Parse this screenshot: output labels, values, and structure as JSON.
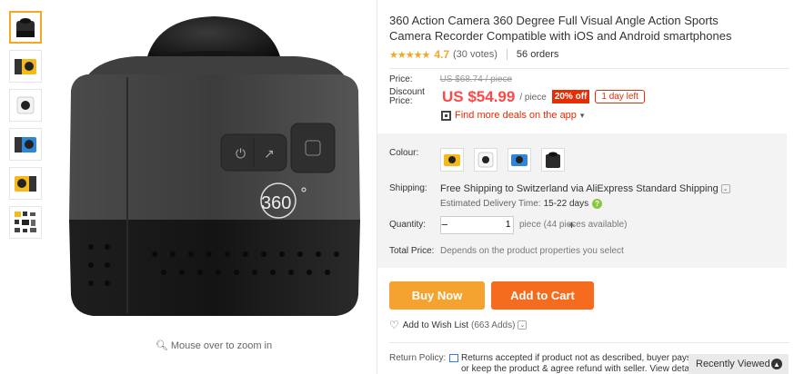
{
  "product": {
    "title": "360 Action Camera 360 Degree Full Visual Angle Action Sports Camera Recorder Compatible with iOS and Android smartphones",
    "rating_stars": "★★★★★",
    "rating": "4.7",
    "votes": "(30 votes)",
    "orders": "56 orders",
    "main_image_text": "360",
    "zoom_hint": "Mouse over to zoom in"
  },
  "thumbnails": [
    {
      "icon": "black-cube-camera-thumb"
    },
    {
      "icon": "yellow-camera-thumb"
    },
    {
      "icon": "white-camera-thumb"
    },
    {
      "icon": "blue-camera-thumb"
    },
    {
      "icon": "yellow-camera-thumb-2"
    },
    {
      "icon": "accessories-thumb"
    }
  ],
  "price": {
    "label": "Price:",
    "old": "US $68.74 / piece",
    "discount_label_1": "Discount",
    "discount_label_2": "Price:",
    "now": "US $54.99",
    "per": "/ piece",
    "percent_off": "20% off",
    "days_left": "1 day left",
    "app_deal": "Find more deals on the app",
    "app_deal_arrow": "▾"
  },
  "options": {
    "colour_label": "Colour:",
    "swatches": [
      "yellow",
      "white",
      "blue",
      "black"
    ],
    "shipping_label": "Shipping:",
    "shipping_text": "Free Shipping to Switzerland via AliExpress Standard Shipping",
    "delivery_label": "Estimated Delivery Time:",
    "delivery_days": "15-22 days",
    "quantity_label": "Quantity:",
    "quantity_value": "1",
    "minus": "−",
    "plus": "+",
    "pieces_available": "piece (44 pieces available)",
    "total_label": "Total Price:",
    "total_note": "Depends on the product properties you select"
  },
  "actions": {
    "buy_now": "Buy Now",
    "add_to_cart": "Add to Cart",
    "wishlist": "Add to Wish List",
    "wish_count": "(663 Adds)"
  },
  "return_policy": {
    "label": "Return Policy:",
    "line1": "Returns accepted if product not as described, buyer pays",
    "line2": "or keep the product & agree refund with seller. View deta"
  },
  "recently_viewed": "Recently Viewed",
  "colors": {
    "accent_orange": "#f5a330",
    "cart_orange": "#f56c1f",
    "price_red": "#ff4747"
  }
}
